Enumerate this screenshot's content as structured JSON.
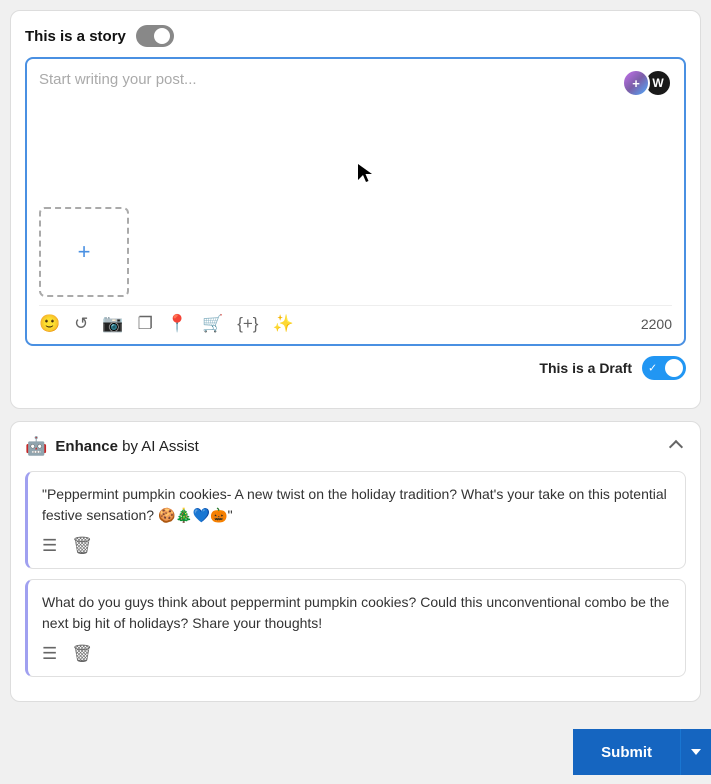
{
  "story": {
    "label": "This is a story",
    "toggle_state": "on"
  },
  "editor": {
    "placeholder": "Start writing your post...",
    "char_count": "2200",
    "avatar_purple_letter": "+",
    "avatar_black_letter": "W",
    "upload_plus": "+"
  },
  "toolbar": {
    "icons": [
      "emoji",
      "refresh",
      "camera",
      "copy",
      "location",
      "cart",
      "code-plus",
      "star"
    ]
  },
  "draft": {
    "label": "This is a Draft"
  },
  "enhance": {
    "title_bold": "Enhance",
    "title_rest": " by AI Assist"
  },
  "suggestions": [
    {
      "text": "\"Peppermint pumpkin cookies- A new twist on the holiday tradition? What's your take on this potential festive sensation? 🍪🎄💙🎃\""
    },
    {
      "text": "What do you guys think about peppermint pumpkin cookies? Could this unconventional combo be the next big hit of holidays? Share your thoughts!"
    }
  ],
  "submit": {
    "label": "Submit"
  }
}
